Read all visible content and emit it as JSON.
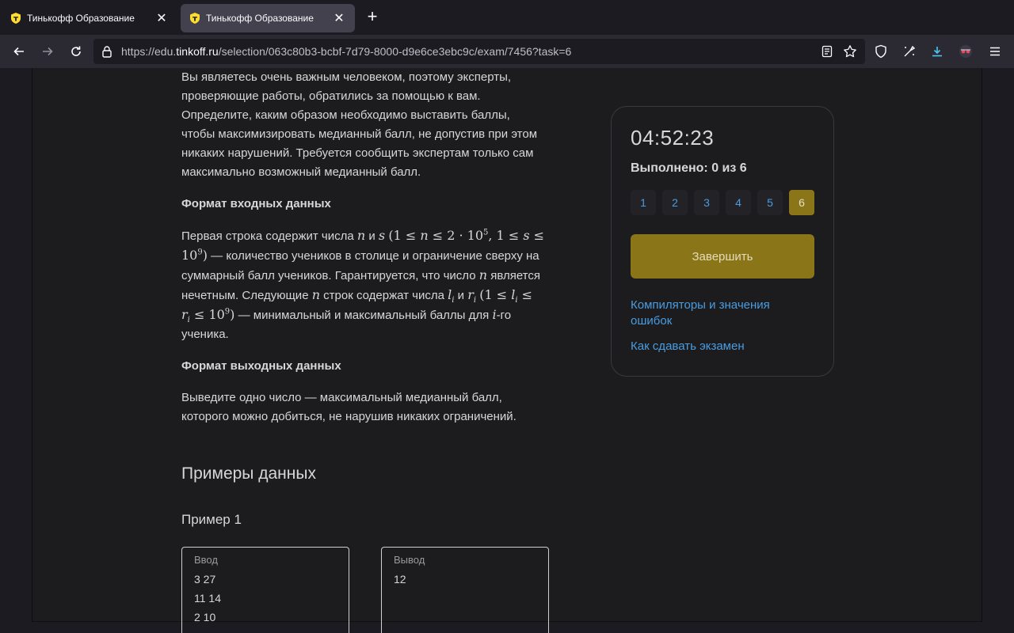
{
  "browser": {
    "tabs": [
      {
        "title": "Тинькофф Образование",
        "active": false
      },
      {
        "title": "Тинькофф Образование",
        "active": true
      }
    ],
    "url_prefix": "https://edu.",
    "url_host": "tinkoff.ru",
    "url_path": "/selection/063c80b3-bcbf-7d79-8000-d9e6ce3ebc9c/exam/7456?task=6",
    "accent_color": "#4a9cdf"
  },
  "problem": {
    "intro": [
      "Вы являетесь очень важным человеком, поэтому эксперты,",
      "проверяющие работы, обратились за помощью к вам.",
      "Определите, каким образом необходимо выставить баллы,",
      "чтобы максимизировать медианный балл, не допустив при этом",
      "никаких нарушений. Требуется сообщить экспертам только сам",
      "максимально возможный медианный балл."
    ],
    "input_heading": "Формат входных данных",
    "output_heading": "Формат выходных данных",
    "input_text": {
      "t1": "Первая строка содержит числа ",
      "and": " и ",
      "t2": " — количество учеников в столице и ограничение сверху на",
      "t3": "суммарный балл учеников. Гарантируется, что число ",
      "t4": " является",
      "t5": "нечетным. Следующие ",
      "t6": " строк содержат числа ",
      "t7": " — минимальный и максимальный баллы для ",
      "t8": "-го",
      "t9": "ученика."
    },
    "output_lines": [
      "Выведите одно число — максимальный медианный балл,",
      "которого можно добиться, не нарушив никаких ограничений."
    ]
  },
  "examples": {
    "section_title": "Примеры данных",
    "example_title": "Пример 1",
    "input_label": "Ввод",
    "input_lines": [
      "3 27",
      "11 14",
      "2 10"
    ],
    "output_label": "Вывод",
    "output_lines": [
      "12"
    ]
  },
  "panel": {
    "timer": "04:52:23",
    "progress": "Выполнено: 0 из 6",
    "tasks": [
      "1",
      "2",
      "3",
      "4",
      "5",
      "6"
    ],
    "current_task": "6",
    "finish_label": "Завершить",
    "link_compilers": "Компиляторы и значения ошибок",
    "link_howto": "Как сдавать экзамен",
    "accent_color": "#8a7519"
  }
}
